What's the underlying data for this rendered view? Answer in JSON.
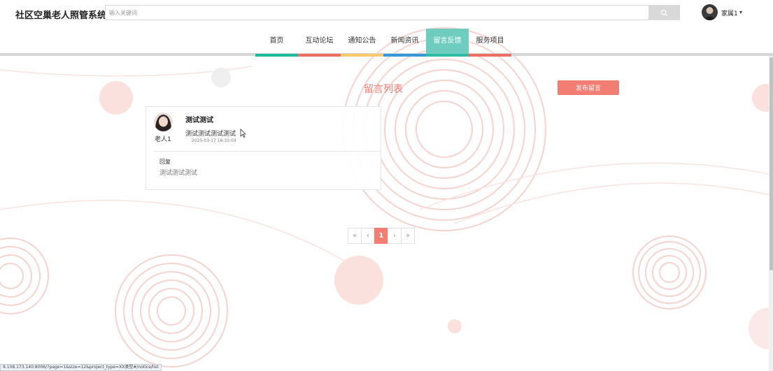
{
  "header": {
    "site_title": "社区空巢老人照管系统",
    "search_placeholder": "输入关键词",
    "username": "家属1"
  },
  "nav": {
    "items": [
      {
        "label": "首页",
        "color": "#1abc9c"
      },
      {
        "label": "互动论坛",
        "color": "#ee6e64"
      },
      {
        "label": "通知公告",
        "color": "#f7c96b"
      },
      {
        "label": "新闻资讯",
        "color": "#3498db"
      },
      {
        "label": "留言反馈",
        "color": "#6fcdbf"
      },
      {
        "label": "服务项目",
        "color": "#ee6e64"
      }
    ],
    "active_index": 4
  },
  "main": {
    "list_title": "留言列表",
    "publish_label": "发布留言"
  },
  "messages": [
    {
      "user": "老人1",
      "title": "测试测试",
      "content": "测试测试测试测试",
      "time": "2025-03-17 16:33:03",
      "reply_label": "回复",
      "reply": "测试测试测试"
    }
  ],
  "pagination": {
    "first": "«",
    "prev": "‹",
    "current": "1",
    "next": "›",
    "last": "»"
  },
  "status_url": "9.108.173.140:8006/?page=1&size=12&project_type=XX类型#/notice/list",
  "colors": {
    "accent": "#f27d72",
    "title": "#ee7b70",
    "decor": "#f6c9c4"
  }
}
